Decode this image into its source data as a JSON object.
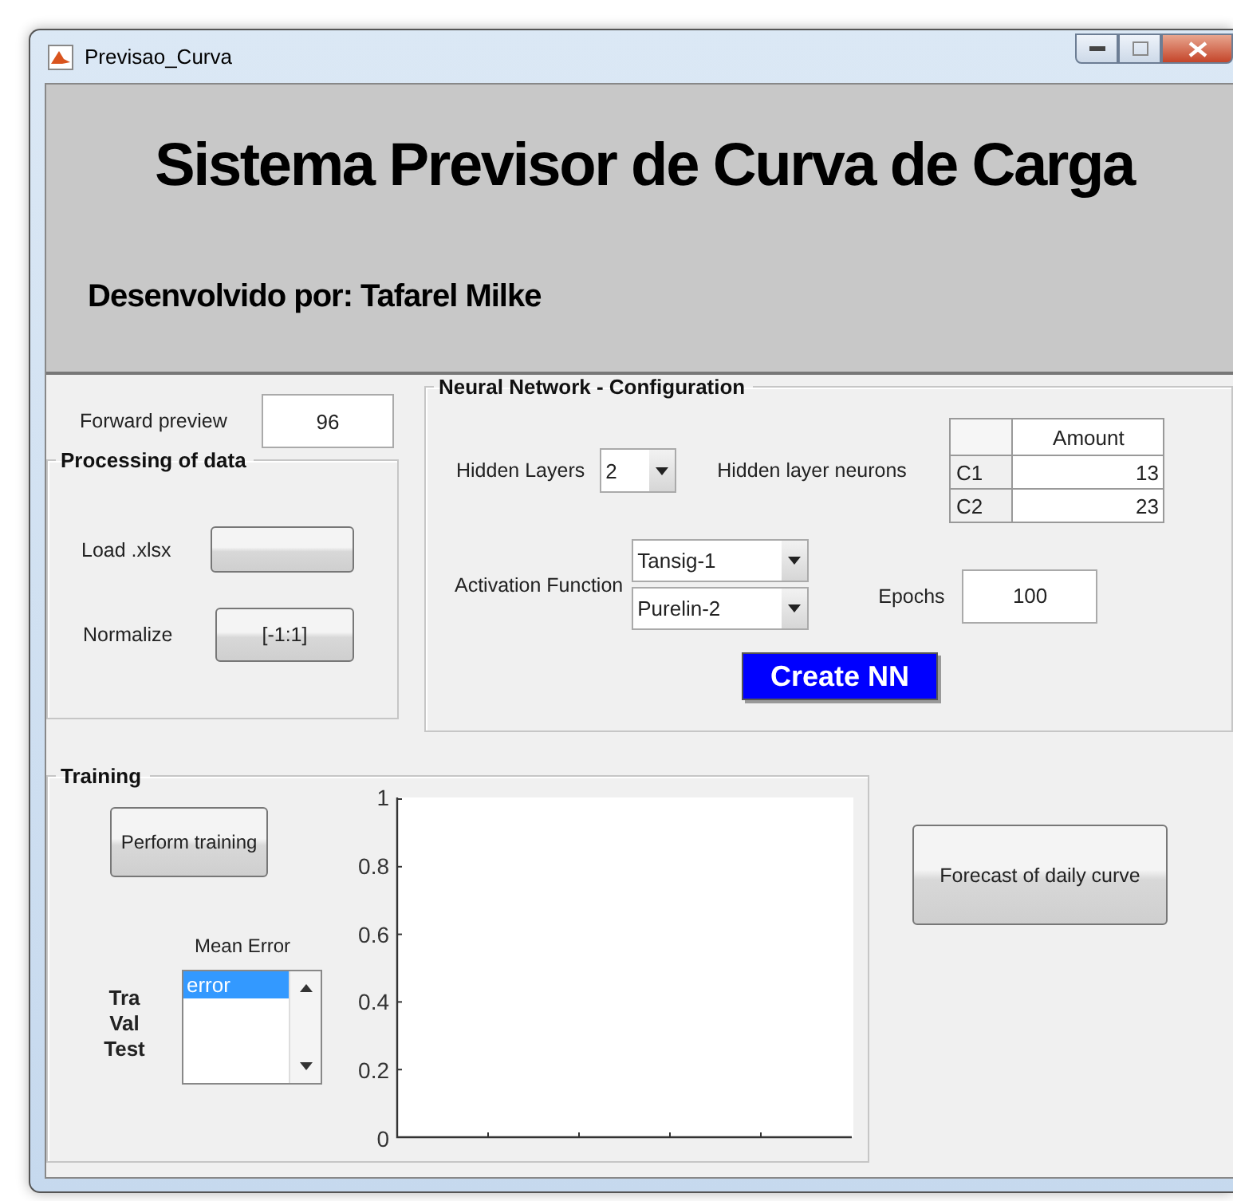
{
  "window": {
    "title": "Previsao_Curva"
  },
  "header": {
    "title": "Sistema Previsor de Curva de Carga",
    "subtitle": "Desenvolvido por: Tafarel Milke"
  },
  "forward_preview": {
    "label": "Forward preview",
    "value": "96"
  },
  "processing": {
    "title": "Processing of data",
    "load_label": "Load .xlsx",
    "normalize_label": "Normalize",
    "normalize_button": "[-1:1]"
  },
  "nn_config": {
    "title": "Neural Network - Configuration",
    "hidden_layers": {
      "label": "Hidden Layers",
      "value": "2"
    },
    "neurons": {
      "label": "Hidden layer neurons",
      "column": "Amount",
      "rows": [
        {
          "name": "C1",
          "amount": "13"
        },
        {
          "name": "C2",
          "amount": "23"
        }
      ]
    },
    "activation": {
      "label": "Activation Function",
      "values": [
        "Tansig-1",
        "Purelin-2"
      ]
    },
    "epochs": {
      "label": "Epochs",
      "value": "100"
    },
    "create_button": "Create NN"
  },
  "training": {
    "title": "Training",
    "perform_button": "Perform training",
    "mean_error_label": "Mean Error",
    "set_labels": [
      "Tra",
      "Val",
      "Test"
    ],
    "error_list": [
      {
        "text": "error",
        "selected": true
      }
    ],
    "plot": {
      "yticks": [
        "1",
        "0.8",
        "0.6",
        "0.4",
        "0.2",
        "0"
      ]
    }
  },
  "forecast_button": "Forecast of daily curve"
}
